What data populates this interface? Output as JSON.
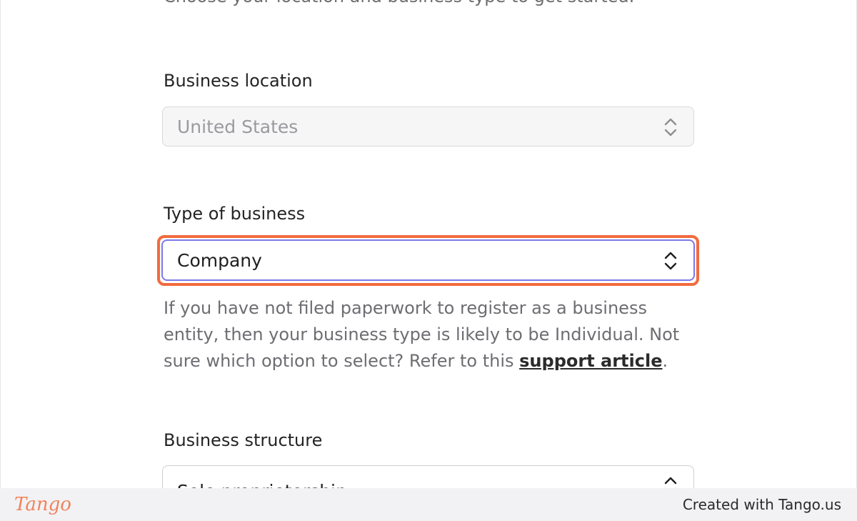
{
  "form": {
    "subtitle": "Choose your location and business type to get started.",
    "business_location": {
      "label": "Business location",
      "value": "United States",
      "disabled": true
    },
    "business_type": {
      "label": "Type of business",
      "value": "Company",
      "help_text_before": "If you have not filed paperwork to register as a business entity, then your business type is likely to be Individual. Not sure which option to select? Refer to this ",
      "help_link": "support article",
      "help_text_after": "."
    },
    "business_structure": {
      "label": "Business structure",
      "value": "Sole proprietorship"
    }
  },
  "icons": {
    "select_arrows": "chevron-up-down-icon"
  },
  "colors": {
    "highlight": "#f26b3f",
    "focus_border": "#7b79e8",
    "tango_brand": "#f0835c"
  },
  "footer": {
    "logo": "Tango",
    "credit": "Created with Tango.us"
  }
}
